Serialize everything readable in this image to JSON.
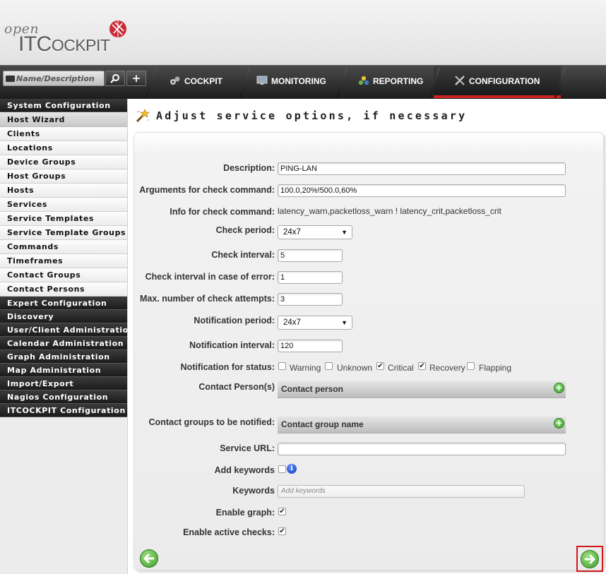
{
  "brand": {
    "open": "open",
    "it": "IT",
    "cockpit_c": "C",
    "cockpit_rest": "OCKPIT"
  },
  "search": {
    "placeholder": "Name/Description"
  },
  "nav": {
    "tabs": [
      {
        "label": "COCKPIT"
      },
      {
        "label": "MONITORING"
      },
      {
        "label": "REPORTING"
      },
      {
        "label": "CONFIGURATION",
        "active": true
      }
    ]
  },
  "sidebar": {
    "items": [
      {
        "label": "System Configuration",
        "style": "dark"
      },
      {
        "label": "Host Wizard",
        "style": "highlight"
      },
      {
        "label": "Clients",
        "style": "sub"
      },
      {
        "label": "Locations",
        "style": "sub"
      },
      {
        "label": "Device Groups",
        "style": "sub"
      },
      {
        "label": "Host Groups",
        "style": "sub"
      },
      {
        "label": "Hosts",
        "style": "sub"
      },
      {
        "label": "Services",
        "style": "sub"
      },
      {
        "label": "Service Templates",
        "style": "sub"
      },
      {
        "label": "Service Template Groups",
        "style": "sub"
      },
      {
        "label": "Commands",
        "style": "sub"
      },
      {
        "label": "Timeframes",
        "style": "sub"
      },
      {
        "label": "Contact Groups",
        "style": "sub"
      },
      {
        "label": "Contact Persons",
        "style": "sub"
      },
      {
        "label": "Expert Configuration",
        "style": "dark"
      },
      {
        "label": "Discovery",
        "style": "dark"
      },
      {
        "label": "User/Client Administration",
        "style": "dark"
      },
      {
        "label": "Calendar Administration",
        "style": "dark"
      },
      {
        "label": "Graph Administration",
        "style": "dark"
      },
      {
        "label": "Map Administration",
        "style": "dark"
      },
      {
        "label": "Import/Export",
        "style": "dark"
      },
      {
        "label": "Nagios Configuration",
        "style": "dark"
      },
      {
        "label": "ITCOCKPIT Configuration",
        "style": "dark"
      }
    ]
  },
  "page": {
    "title": "Adjust service options, if necessary"
  },
  "form": {
    "description": {
      "label": "Description:",
      "value": "PING-LAN"
    },
    "arguments": {
      "label": "Arguments for check command:",
      "value": "100.0,20%!500.0,60%"
    },
    "info": {
      "label": "Info for check command:",
      "value": "latency_warn,packetloss_warn ! latency_crit,packetloss_crit"
    },
    "check_period": {
      "label": "Check period:",
      "value": "24x7"
    },
    "check_interval": {
      "label": "Check interval:",
      "value": "5"
    },
    "retry_interval": {
      "label": "Check interval in case of error:",
      "value": "1"
    },
    "max_attempts": {
      "label": "Max. number of check attempts:",
      "value": "3"
    },
    "notification_period": {
      "label": "Notification period:",
      "value": "24x7"
    },
    "notification_interval": {
      "label": "Notification interval:",
      "value": "120"
    },
    "notification_status": {
      "label": "Notification for status:",
      "options": [
        {
          "label": "Warning",
          "checked": false
        },
        {
          "label": "Unknown",
          "checked": false
        },
        {
          "label": "Critical",
          "checked": true
        },
        {
          "label": "Recovery",
          "checked": true
        },
        {
          "label": "Flapping",
          "checked": false
        }
      ]
    },
    "contact_persons": {
      "label": "Contact Person(s)",
      "header": "Contact person"
    },
    "contact_groups": {
      "label": "Contact groups to be notified:",
      "header": "Contact group name"
    },
    "service_url": {
      "label": "Service URL:",
      "value": ""
    },
    "add_keywords": {
      "label": "Add keywords",
      "checked": false
    },
    "keywords": {
      "label": "Keywords",
      "placeholder": "Add keywords"
    },
    "enable_graph": {
      "label": "Enable graph:",
      "checked": true
    },
    "enable_active_checks": {
      "label": "Enable active checks:",
      "checked": true
    }
  },
  "colors": {
    "accent": "#cc2222",
    "nav_bg": "#1d1d1d",
    "button_green": "#3f9b2e"
  },
  "icons": {
    "back": "arrow-left-icon",
    "next": "arrow-right-icon",
    "info": "info-icon",
    "add": "plus-icon"
  }
}
